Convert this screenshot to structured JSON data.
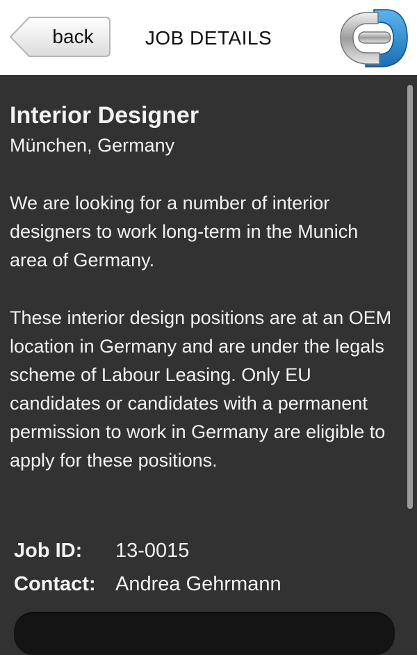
{
  "header": {
    "back_label": "back",
    "title": "JOB DETAILS"
  },
  "job": {
    "title": "Interior Designer",
    "location": "München, Germany",
    "description_1": "We are looking for a number of interior designers to work long-term in the Munich area of Germany.",
    "description_2": "These interior design positions are at an OEM location in Germany and are under the legals scheme of Labour Leasing. Only EU candidates or candidates with a permanent permission to work in Germany are eligible to apply for these positions.",
    "id_label": "Job ID:",
    "id_value": "13-0015",
    "contact_label": "Contact:",
    "contact_value": "Andrea Gehrmann"
  },
  "colors": {
    "header_bg": "#ffffff",
    "content_bg": "#323232",
    "text": "#f2f2f2",
    "logo_blue": "#2a8fd6"
  }
}
